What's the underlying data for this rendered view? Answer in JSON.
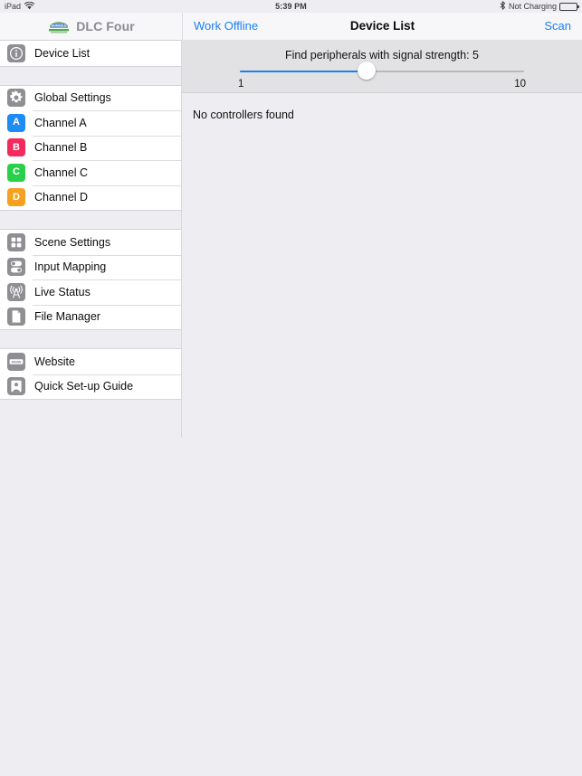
{
  "status_bar": {
    "device": "iPad",
    "wifi_icon": "wifi-icon",
    "time": "5:39 PM",
    "bluetooth_icon": "bluetooth-icon",
    "charging_status": "Not Charging",
    "battery_icon": "battery-icon"
  },
  "header": {
    "brand_logo_icon": "durable-logo-icon",
    "brand_name": "DLC Four",
    "left_button": "Work Offline",
    "title": "Device List",
    "right_button": "Scan"
  },
  "sidebar": {
    "groups": [
      {
        "items": [
          {
            "label": "Device List",
            "icon": "info-icon",
            "badge": null,
            "color": "#8e8e93"
          }
        ]
      },
      {
        "items": [
          {
            "label": "Global Settings",
            "icon": "gear-icon",
            "badge": null,
            "color": "#8e8e93"
          },
          {
            "label": "Channel A",
            "icon": "channel-badge-icon",
            "badge": "A",
            "color": "#1e8cf5"
          },
          {
            "label": "Channel B",
            "icon": "channel-badge-icon",
            "badge": "B",
            "color": "#f42a5e"
          },
          {
            "label": "Channel C",
            "icon": "channel-badge-icon",
            "badge": "C",
            "color": "#2ad04b"
          },
          {
            "label": "Channel D",
            "icon": "channel-badge-icon",
            "badge": "D",
            "color": "#f5a11f"
          }
        ]
      },
      {
        "items": [
          {
            "label": "Scene Settings",
            "icon": "grid-squares-icon",
            "badge": null,
            "color": "#8e8e93"
          },
          {
            "label": "Input Mapping",
            "icon": "toggle-switches-icon",
            "badge": null,
            "color": "#8e8e93"
          },
          {
            "label": "Live Status",
            "icon": "broadcast-tower-icon",
            "badge": null,
            "color": "#8e8e93"
          },
          {
            "label": "File Manager",
            "icon": "document-icon",
            "badge": null,
            "color": "#8e8e93"
          }
        ]
      },
      {
        "items": [
          {
            "label": "Website",
            "icon": "www-icon",
            "badge": "www",
            "color": "#8e8e93"
          },
          {
            "label": "Quick Set-up Guide",
            "icon": "person-icon",
            "badge": null,
            "color": "#8e8e93"
          }
        ]
      }
    ]
  },
  "main": {
    "slider": {
      "caption": "Find peripherals with signal strength: 5",
      "value": 5,
      "min_label": "1",
      "max_label": "10",
      "min": 1,
      "max": 10,
      "accent_color": "#1b7ef3"
    },
    "empty_message": "No controllers found"
  }
}
